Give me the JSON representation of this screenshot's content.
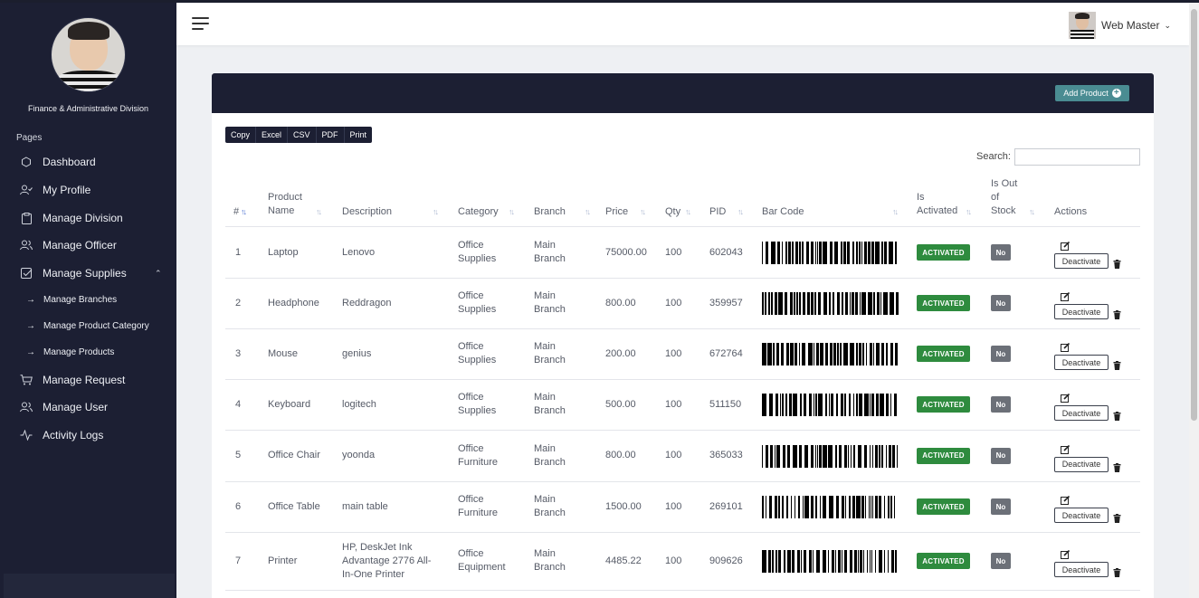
{
  "sidebar": {
    "division": "Finance & Administrative Division",
    "pages_label": "Pages",
    "items": [
      {
        "label": "Dashboard",
        "icon": "hexagon-icon"
      },
      {
        "label": "My Profile",
        "icon": "user-check-icon"
      },
      {
        "label": "Manage Division",
        "icon": "clipboard-icon"
      },
      {
        "label": "Manage Officer",
        "icon": "users-icon"
      },
      {
        "label": "Manage Supplies",
        "icon": "check-square-icon"
      },
      {
        "label": "Manage Request",
        "icon": "cart-icon"
      },
      {
        "label": "Manage User",
        "icon": "users-icon"
      },
      {
        "label": "Activity Logs",
        "icon": "activity-icon"
      }
    ],
    "subitems": [
      {
        "label": "Manage Branches"
      },
      {
        "label": "Manage Product Category"
      },
      {
        "label": "Manage Products"
      }
    ]
  },
  "header": {
    "user_name": "Web Master"
  },
  "card": {
    "add_button": "Add Product",
    "export_buttons": [
      "Copy",
      "Excel",
      "CSV",
      "PDF",
      "Print"
    ],
    "search_label": "Search:",
    "search_value": ""
  },
  "table": {
    "columns": [
      "#",
      "Product Name",
      "Description",
      "Category",
      "Branch",
      "Price",
      "Qty",
      "PID",
      "Bar Code",
      "Is Activated",
      "Is Out of Stock",
      "Actions"
    ],
    "status_label": "ACTIVATED",
    "stock_label": "No",
    "deactivate_label": "Deactivate",
    "rows": [
      {
        "num": "1",
        "name": "Laptop",
        "description": "Lenovo",
        "category": "Office Supplies",
        "branch": "Main Branch",
        "price": "75000.00",
        "qty": "100",
        "pid": "602043"
      },
      {
        "num": "2",
        "name": "Headphone",
        "description": "Reddragon",
        "category": "Office Supplies",
        "branch": "Main Branch",
        "price": "800.00",
        "qty": "100",
        "pid": "359957"
      },
      {
        "num": "3",
        "name": "Mouse",
        "description": "genius",
        "category": "Office Supplies",
        "branch": "Main Branch",
        "price": "200.00",
        "qty": "100",
        "pid": "672764"
      },
      {
        "num": "4",
        "name": "Keyboard",
        "description": "logitech",
        "category": "Office Supplies",
        "branch": "Main Branch",
        "price": "500.00",
        "qty": "100",
        "pid": "511150"
      },
      {
        "num": "5",
        "name": "Office Chair",
        "description": "yoonda",
        "category": "Office Furniture",
        "branch": "Main Branch",
        "price": "800.00",
        "qty": "100",
        "pid": "365033"
      },
      {
        "num": "6",
        "name": "Office Table",
        "description": "main table",
        "category": "Office Furniture",
        "branch": "Main Branch",
        "price": "1500.00",
        "qty": "100",
        "pid": "269101"
      },
      {
        "num": "7",
        "name": "Printer",
        "description": "HP, DeskJet Ink Advantage 2776 All-In-One Printer",
        "category": "Office Equipment",
        "branch": "Main Branch",
        "price": "4485.22",
        "qty": "100",
        "pid": "909626"
      }
    ]
  },
  "colors": {
    "sidebar_bg": "#1c1f33",
    "activated": "#2e8b3e",
    "add_button": "#4a8c92",
    "badge_no": "#6c7078"
  }
}
